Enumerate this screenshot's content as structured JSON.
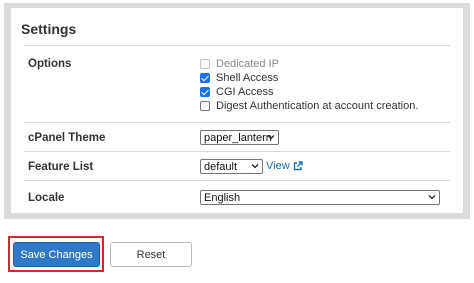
{
  "panel": {
    "title": "Settings"
  },
  "options": {
    "label": "Options",
    "items": [
      {
        "label": "Dedicated IP",
        "checked": false,
        "disabled": true
      },
      {
        "label": "Shell Access",
        "checked": true,
        "disabled": false
      },
      {
        "label": "CGI Access",
        "checked": true,
        "disabled": false
      },
      {
        "label": "Digest Authentication at account creation.",
        "checked": false,
        "disabled": false
      }
    ]
  },
  "cpanel_theme": {
    "label": "cPanel Theme",
    "value": "paper_lantern"
  },
  "feature_list": {
    "label": "Feature List",
    "value": "default",
    "view_link": "View"
  },
  "locale": {
    "label": "Locale",
    "value": "English"
  },
  "buttons": {
    "save": "Save Changes",
    "reset": "Reset"
  },
  "colors": {
    "accent": "#2f79c8",
    "highlight_border": "#d9262c",
    "link": "#1a6fb0"
  },
  "icons": {
    "external_link": "external-link-icon",
    "dropdown": "chevron-down-icon"
  }
}
